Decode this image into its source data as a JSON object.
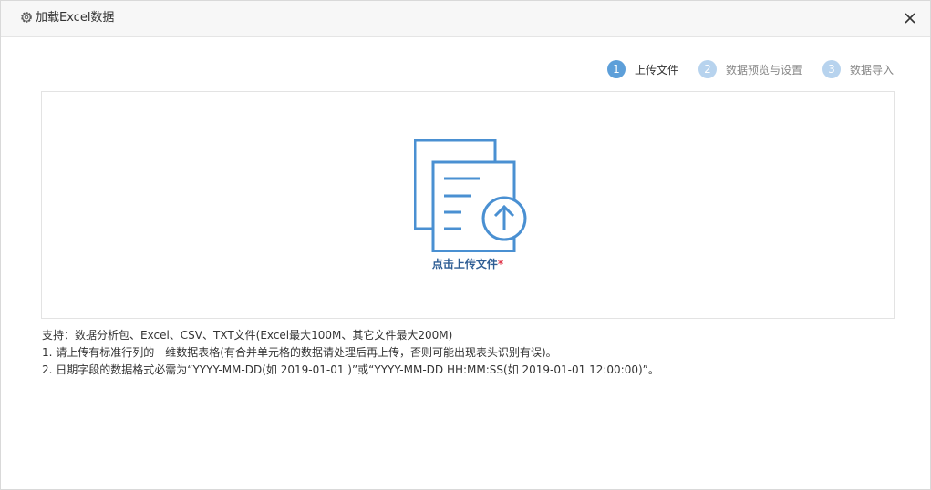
{
  "dialog": {
    "title": "加载Excel数据",
    "icons": {
      "settings": "gear-icon",
      "close": "close-icon"
    }
  },
  "steps": [
    {
      "number": "1",
      "label": "上传文件",
      "state": "active"
    },
    {
      "number": "2",
      "label": "数据预览与设置",
      "state": "inactive"
    },
    {
      "number": "3",
      "label": "数据导入",
      "state": "inactive"
    }
  ],
  "upload": {
    "label": "点击上传文件",
    "required_mark": "*",
    "icon": "file-upload-icon"
  },
  "notes": {
    "support": "支持：数据分析包、Excel、CSV、TXT文件(Excel最大100M、其它文件最大200M)",
    "rule_1": "1. 请上传有标准行列的一维数据表格(有合并单元格的数据请处理后再上传，否则可能出现表头识别有误)。",
    "rule_2": "2. 日期字段的数据格式必需为“YYYY-MM-DD(如 2019-01-01 )”或“YYYY-MM-DD HH:MM:SS(如 2019-01-01 12:00:00)”。"
  },
  "colors": {
    "accent": "#5d9fd9",
    "step_inactive": "#b7d3ee",
    "upload_text": "#2e5d94",
    "required": "#e0364b"
  }
}
